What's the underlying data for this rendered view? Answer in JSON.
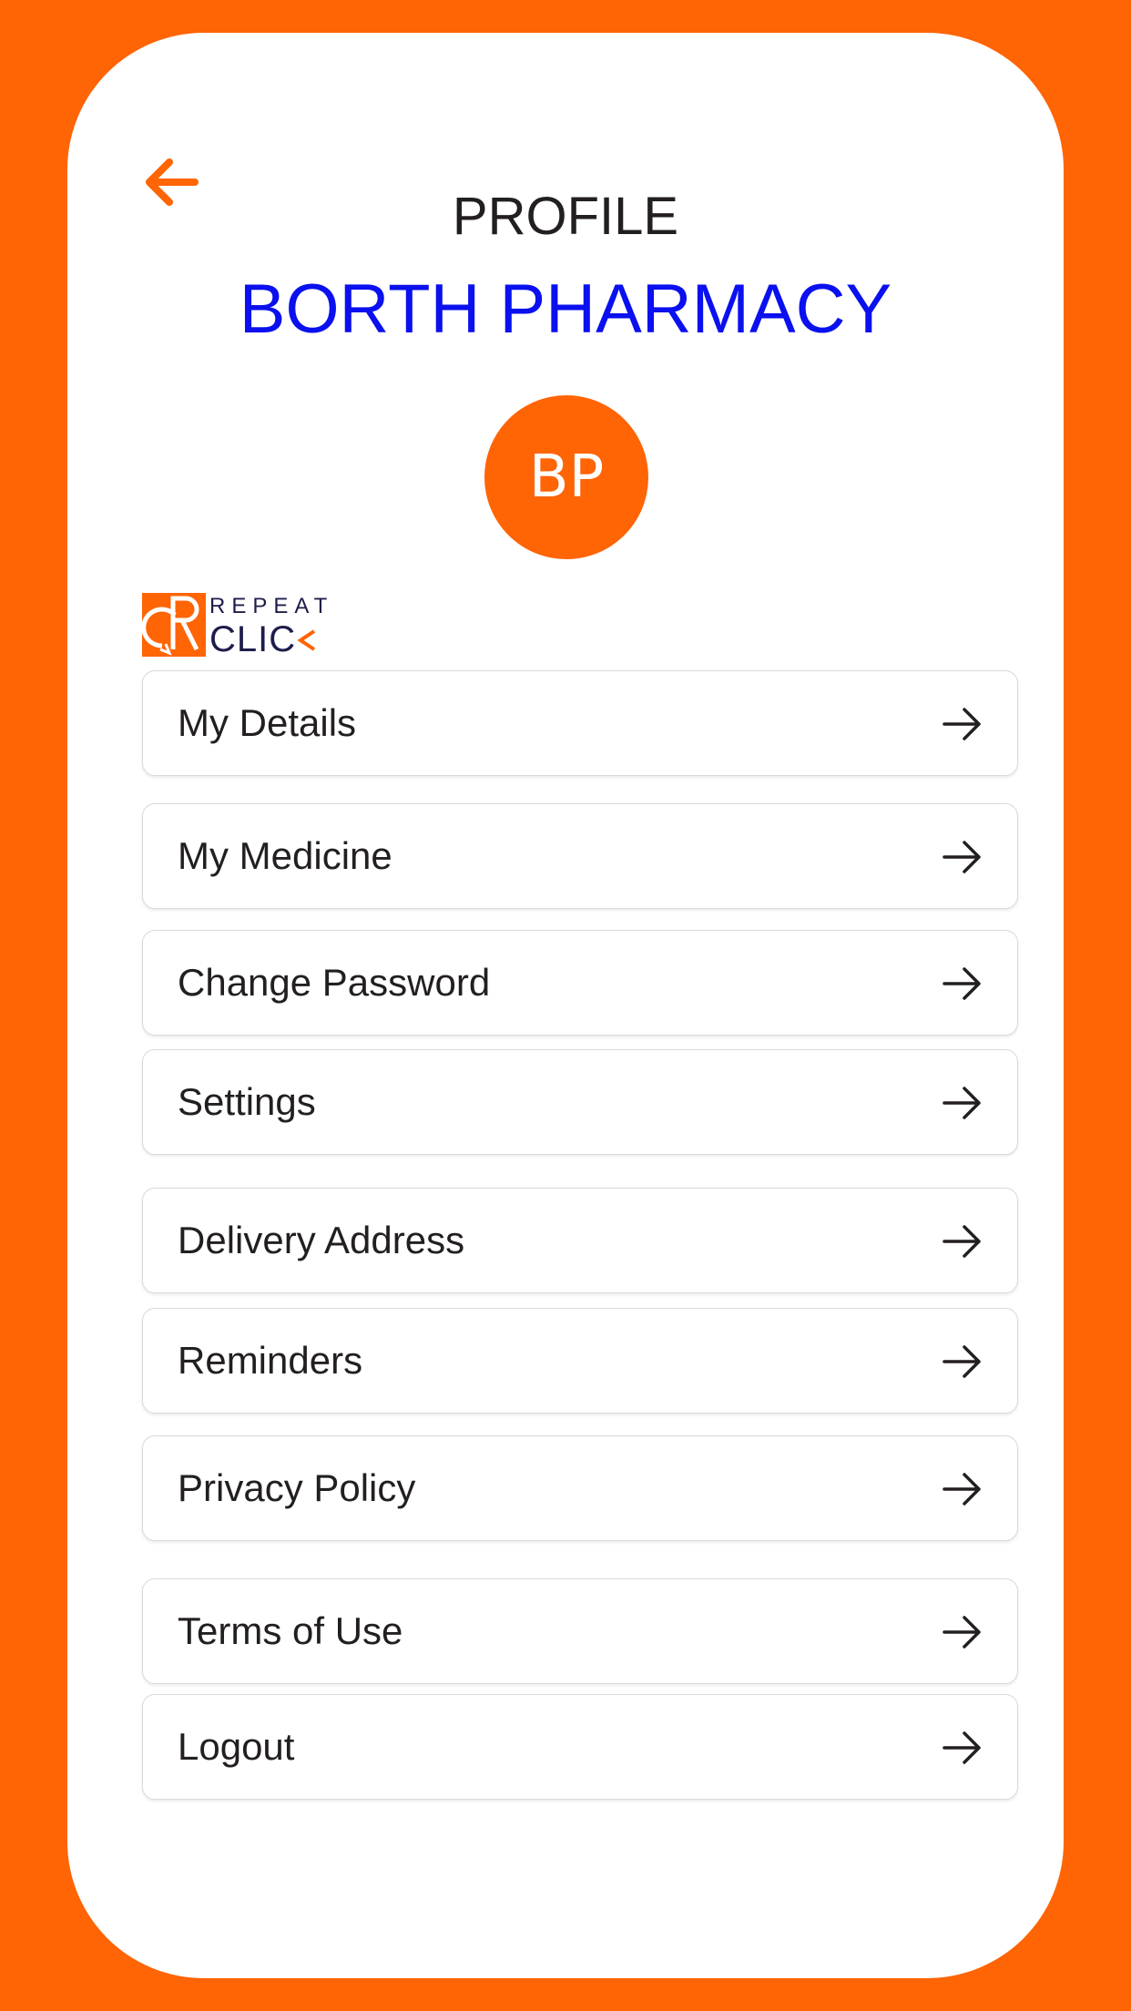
{
  "header": {
    "title": "PROFILE",
    "store_name": "BORTH PHARMACY",
    "back_icon": "arrow-left-icon"
  },
  "profile": {
    "avatar_initials": "BP"
  },
  "logo": {
    "top_text": "REPEAT",
    "bottom_text": "CLIC"
  },
  "menu": {
    "arrow_icon": "arrow-right-icon",
    "items": [
      {
        "label": "My Details"
      },
      {
        "label": "My Medicine"
      },
      {
        "label": "Change Password"
      },
      {
        "label": "Settings"
      },
      {
        "label": "Delivery Address"
      },
      {
        "label": "Reminders"
      },
      {
        "label": "Privacy Policy"
      },
      {
        "label": "Terms of Use"
      },
      {
        "label": "Logout"
      }
    ]
  },
  "colors": {
    "accent": "#ff6405",
    "store_name": "#0a10ee",
    "text": "#231f20",
    "background": "#ffffff"
  }
}
